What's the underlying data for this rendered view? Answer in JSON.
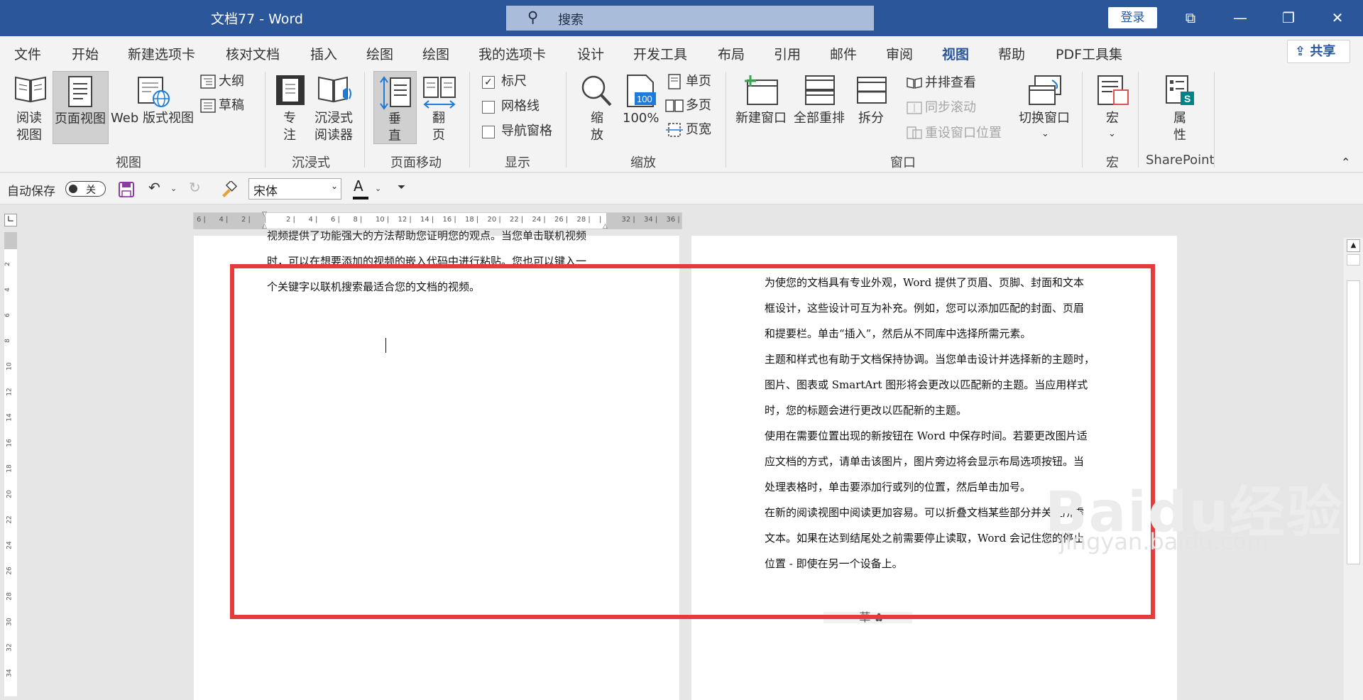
{
  "titlebar": {
    "title": "文档77  -  Word",
    "search_placeholder": "搜索",
    "login": "登录",
    "btn_ribbon_display": "⧉",
    "btn_minimize": "—",
    "btn_restore": "❐",
    "btn_close": "✕"
  },
  "menu": {
    "tabs": [
      "文件",
      "开始",
      "新建选项卡",
      "核对文档",
      "插入",
      "绘图",
      "绘图",
      "我的选项卡",
      "设计",
      "开发工具",
      "布局",
      "引用",
      "邮件",
      "审阅",
      "视图",
      "帮助",
      "PDF工具集"
    ],
    "active": "视图",
    "share": "共享"
  },
  "ribbon": {
    "views": {
      "read_mode": [
        "阅读",
        "视图"
      ],
      "print_layout": "页面视图",
      "web_layout": "Web 版式视图",
      "outline": "大纲",
      "draft": "草稿",
      "group": "视图"
    },
    "immersive": {
      "focus": [
        "专",
        "注"
      ],
      "reader": [
        "沉浸式",
        "阅读器"
      ],
      "group": "沉浸式"
    },
    "page_movement": {
      "vertical": [
        "垂",
        "直"
      ],
      "side": [
        "翻",
        "页"
      ],
      "group": "页面移动"
    },
    "show": {
      "ruler": "标尺",
      "ruler_checked": true,
      "gridlines": "网格线",
      "gridlines_checked": false,
      "nav_pane": "导航窗格",
      "nav_pane_checked": false,
      "group": "显示"
    },
    "zoom": {
      "zoom": [
        "缩",
        "放"
      ],
      "percent": "100%",
      "icon_text": "100",
      "one_page": "单页",
      "multi_page": "多页",
      "page_width": "页宽",
      "group": "缩放"
    },
    "window": {
      "new_window": "新建窗口",
      "arrange_all": "全部重排",
      "split": "拆分",
      "side_by_side": "并排查看",
      "sync_scroll": "同步滚动",
      "reset_pos": "重设窗口位置",
      "switch": "切换窗口",
      "group": "窗口"
    },
    "macros": {
      "macro": "宏",
      "group": "宏"
    },
    "sharepoint": {
      "properties": [
        "属",
        "性"
      ],
      "group": "SharePoint"
    }
  },
  "qat": {
    "autosave": "自动保存",
    "autosave_state": "关",
    "font_name": "宋体",
    "font_color_glyph": "A"
  },
  "ruler": {
    "h_ticks": [
      "6",
      "4",
      "2",
      "",
      "2",
      "4",
      "6",
      "8",
      "10",
      "12",
      "14",
      "16",
      "18",
      "20",
      "22",
      "24",
      "26",
      "28",
      "",
      "32",
      "34",
      "36"
    ],
    "v_ticks": [
      "2",
      "4",
      "6",
      "8",
      "10",
      "12",
      "14",
      "16",
      "18",
      "20",
      "22",
      "24",
      "26",
      "28",
      "30",
      "32",
      "34"
    ]
  },
  "left_page": {
    "lines": [
      "视频提供了功能强大的方法帮助您证明您的观点。当您单击联机视频",
      "时，可以在想要添加的视频的嵌入代码中进行粘贴。您也可以键入一",
      "个关键字以联机搜索最适合您的文档的视频。"
    ]
  },
  "right_page": {
    "lines": [
      "为使您的文档具有专业外观，Word 提供了页眉、页脚、封面和文本",
      "框设计，这些设计可互为补充。例如，您可以添加匹配的封面、页眉",
      "和提要栏。单击“插入”，然后从不同库中选择所需元素。",
      "主题和样式也有助于文档保持协调。当您单击设计并选择新的主题时，",
      "图片、图表或 SmartArt 图形将会更改以匹配新的主题。当应用样式",
      "时，您的标题会进行更改以匹配新的主题。",
      "使用在需要位置出现的新按钮在 Word 中保存时间。若要更改图片适",
      "应文档的方式，请单击该图片，图片旁边将会显示布局选项按钮。当",
      "处理表格时，单击要添加行或列的位置，然后单击加号。",
      "在新的阅读视图中阅读更加容易。可以折叠文档某些部分并关注所需",
      "文本。如果在达到结尾处之前需要停止读取，Word 会记住您的停止",
      "位置 - 即使在另一个设备上。"
    ]
  },
  "watermark": {
    "brand": "Baidu经验",
    "url": "jingyan.baidu.com"
  },
  "colors": {
    "accent": "#2b579a",
    "highlight": "#e63b3b"
  }
}
